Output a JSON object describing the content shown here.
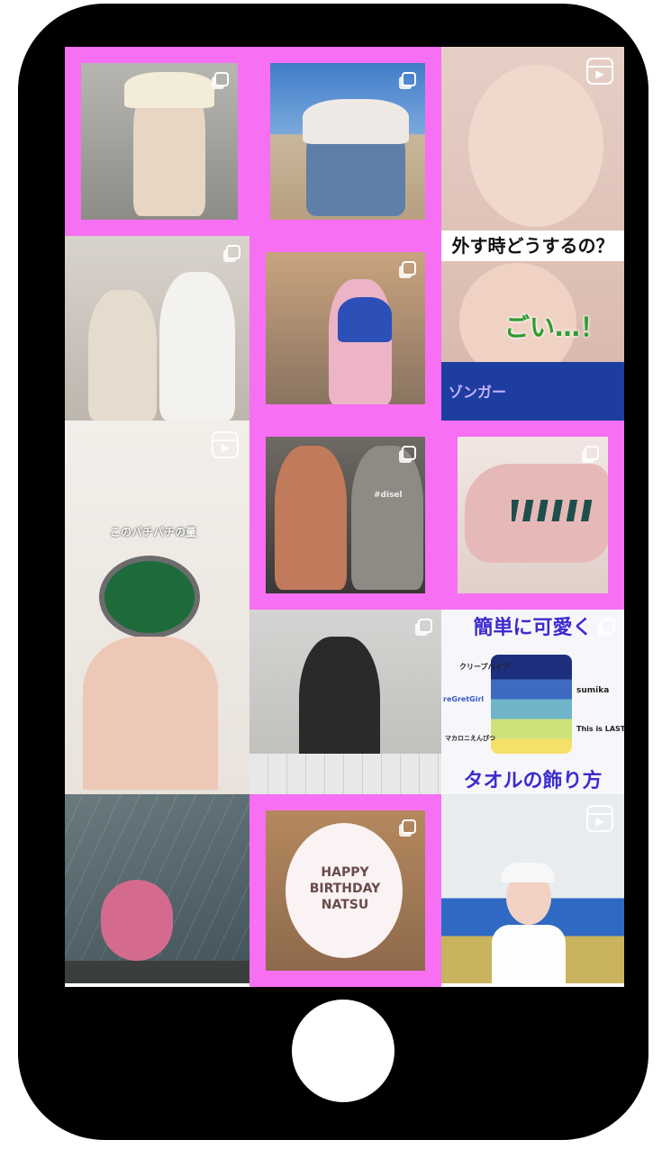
{
  "posts": [
    {
      "id": "p1",
      "type": "post"
    },
    {
      "id": "p2",
      "type": "post"
    },
    {
      "id": "p3",
      "type": "reel",
      "caption_top": "外す時どうするの？",
      "caption_overlay": "ごい…！",
      "shirt_text": "ゾンガー"
    },
    {
      "id": "p4",
      "type": "post"
    },
    {
      "id": "p5",
      "type": "post"
    },
    {
      "id": "p6",
      "type": "reel",
      "caption": "このパチパチの量"
    },
    {
      "id": "p7",
      "type": "post",
      "shirt_text": "#disel"
    },
    {
      "id": "p8",
      "type": "post"
    },
    {
      "id": "p9",
      "type": "post"
    },
    {
      "id": "p10",
      "type": "post",
      "caption_top": "簡単に可愛く",
      "caption_bottom": "タオルの飾り方",
      "labels": [
        "クリープハイプ",
        "sumika",
        "reGretGirl",
        "This is LAST",
        "マカロニえんぴつ"
      ]
    },
    {
      "id": "p11",
      "type": "post"
    },
    {
      "id": "p12",
      "type": "post",
      "cake_text": "HAPPY BIRTHDAY NATSU"
    },
    {
      "id": "p13",
      "type": "reel"
    }
  ],
  "colors": {
    "highlight": "#f76ff3",
    "phone": "#000000",
    "screen": "#ffffff"
  }
}
